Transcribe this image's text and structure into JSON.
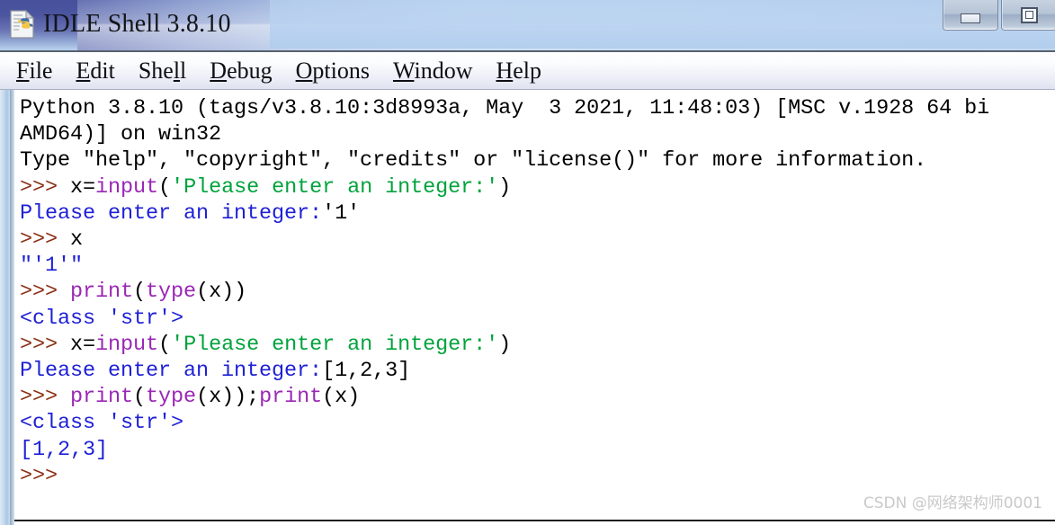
{
  "window": {
    "title": "IDLE Shell 3.8.10",
    "icon": "python-idle-icon",
    "controls": {
      "minimize_label": "Minimize",
      "maximize_label": "Restore"
    }
  },
  "menubar": {
    "items": [
      {
        "label": "File",
        "accel": "F"
      },
      {
        "label": "Edit",
        "accel": "E"
      },
      {
        "label": "Shell",
        "accel": "l"
      },
      {
        "label": "Debug",
        "accel": "D"
      },
      {
        "label": "Options",
        "accel": "O"
      },
      {
        "label": "Window",
        "accel": "W"
      },
      {
        "label": "Help",
        "accel": "H"
      }
    ]
  },
  "console": {
    "lines": [
      {
        "id": "banner-1",
        "segments": [
          {
            "text": "Python 3.8.10 (tags/v3.8.10:3d8993a, May  3 2021, 11:48:03) [MSC v.1928 64 bi",
            "style": "plain"
          }
        ]
      },
      {
        "id": "banner-2",
        "segments": [
          {
            "text": "AMD64)] on win32",
            "style": "plain"
          }
        ]
      },
      {
        "id": "banner-3",
        "segments": [
          {
            "text": "Type \"help\", \"copyright\", \"credits\" or \"license()\" for more information.",
            "style": "plain"
          }
        ]
      },
      {
        "id": "input-1",
        "segments": [
          {
            "text": ">>> ",
            "style": "prompt"
          },
          {
            "text": "x=",
            "style": "plain"
          },
          {
            "text": "input",
            "style": "builtin"
          },
          {
            "text": "(",
            "style": "plain"
          },
          {
            "text": "'Please enter an integer:'",
            "style": "string"
          },
          {
            "text": ")",
            "style": "plain"
          }
        ]
      },
      {
        "id": "output-1",
        "segments": [
          {
            "text": "Please enter an integer:",
            "style": "output"
          },
          {
            "text": "'1'",
            "style": "plain"
          }
        ]
      },
      {
        "id": "input-2",
        "segments": [
          {
            "text": ">>> ",
            "style": "prompt"
          },
          {
            "text": "x",
            "style": "plain"
          }
        ]
      },
      {
        "id": "output-2",
        "segments": [
          {
            "text": "\"'1'\"",
            "style": "output"
          }
        ]
      },
      {
        "id": "input-3",
        "segments": [
          {
            "text": ">>> ",
            "style": "prompt"
          },
          {
            "text": "print",
            "style": "builtin"
          },
          {
            "text": "(",
            "style": "plain"
          },
          {
            "text": "type",
            "style": "builtin"
          },
          {
            "text": "(x))",
            "style": "plain"
          }
        ]
      },
      {
        "id": "output-3",
        "segments": [
          {
            "text": "<class 'str'>",
            "style": "output"
          }
        ]
      },
      {
        "id": "input-4",
        "segments": [
          {
            "text": ">>> ",
            "style": "prompt"
          },
          {
            "text": "x=",
            "style": "plain"
          },
          {
            "text": "input",
            "style": "builtin"
          },
          {
            "text": "(",
            "style": "plain"
          },
          {
            "text": "'Please enter an integer:'",
            "style": "string"
          },
          {
            "text": ")",
            "style": "plain"
          }
        ]
      },
      {
        "id": "output-4",
        "segments": [
          {
            "text": "Please enter an integer:",
            "style": "output"
          },
          {
            "text": "[1,2,3]",
            "style": "plain"
          }
        ]
      },
      {
        "id": "input-5",
        "segments": [
          {
            "text": ">>> ",
            "style": "prompt"
          },
          {
            "text": "print",
            "style": "builtin"
          },
          {
            "text": "(",
            "style": "plain"
          },
          {
            "text": "type",
            "style": "builtin"
          },
          {
            "text": "(x));",
            "style": "plain"
          },
          {
            "text": "print",
            "style": "builtin"
          },
          {
            "text": "(x)",
            "style": "plain"
          }
        ]
      },
      {
        "id": "output-5",
        "segments": [
          {
            "text": "<class 'str'>",
            "style": "output"
          }
        ]
      },
      {
        "id": "output-6",
        "segments": [
          {
            "text": "[1,2,3]",
            "style": "output"
          }
        ]
      },
      {
        "id": "input-6",
        "segments": [
          {
            "text": ">>>",
            "style": "prompt"
          }
        ]
      }
    ]
  },
  "watermark": {
    "text": "CSDN @网络架构师0001"
  },
  "colors": {
    "prompt": "#8b2f16",
    "builtin": "#9a27b5",
    "string": "#00a33c",
    "output": "#1f21d6",
    "plain": "#000000",
    "titlebar_accent": "#4b55a0",
    "console_background": "#ffffff"
  }
}
